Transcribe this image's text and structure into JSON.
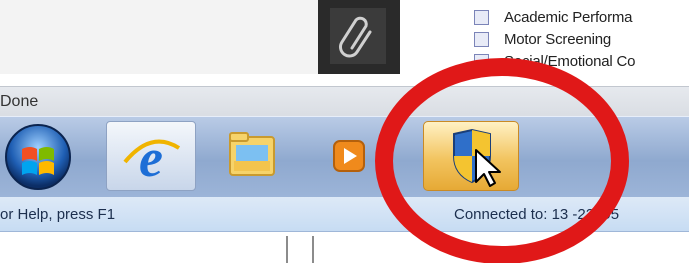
{
  "checklist": {
    "items": [
      {
        "label": "Academic Performa"
      },
      {
        "label": "Motor Screening"
      },
      {
        "label": "Social/Emotional Co"
      }
    ]
  },
  "statusbar": {
    "text": "Done"
  },
  "taskbar": {
    "buttons": [
      {
        "name": "start-orb"
      },
      {
        "name": "internet-explorer"
      },
      {
        "name": "windows-explorer"
      },
      {
        "name": "media-player"
      },
      {
        "name": "uac-shield"
      }
    ]
  },
  "helpbar": {
    "help_text": "or Help, press F1",
    "connection_text": "Connected to: 13 -22895"
  },
  "colors": {
    "annotation_red": "#e01818",
    "taskbar_blue": "#9cb4d8",
    "uac_highlight": "#f2c45f"
  },
  "icons": [
    "paperclip-icon",
    "windows-logo-icon",
    "ie-logo-icon",
    "folder-icon",
    "media-play-icon",
    "shield-icon",
    "cursor-icon"
  ]
}
